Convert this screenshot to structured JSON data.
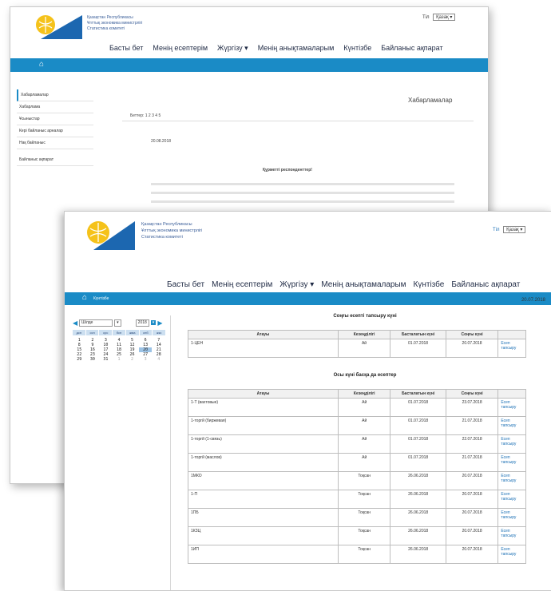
{
  "back_window": {
    "org_lines": [
      "Қазақстан Республикасы",
      "Ұлттық экономика министрлігі",
      "Статистика комитеті"
    ],
    "lang_label": "Тіл",
    "lang_value": "Қазақ",
    "nav": [
      "Басты бет",
      "Менің есептерім",
      "Жүргізу",
      "Менің анықтамаларым",
      "Күнтізбе",
      "Байланыс ақпарат"
    ],
    "sidebar": [
      "Хабарламалар",
      "Хабарлама",
      "Ұсыныстар",
      "Кері байланыс арналар",
      "Нақ байланыс",
      "Байланыс ақпарат"
    ],
    "page_title": "Хабарламалар",
    "pager": "Беттер: 1 2 3 4 5",
    "date": "20.08.2018",
    "heading": "Құрметті респонденттер!"
  },
  "front_window": {
    "org_lines": [
      "Қазақстан Республикасы",
      "Ұлттық экономика министрлігі",
      "Статистика комитеті"
    ],
    "lang_label": "Тіл",
    "lang_value": "Қазақ",
    "nav": [
      "Басты бет",
      "Менің есептерім",
      "Жүргізу",
      "Менің анықтамаларым",
      "Күнтізбе",
      "Байланыс ақпарат"
    ],
    "crumb": "Күнтізбе",
    "calendar": {
      "month": "Шілде",
      "year": "2018",
      "weekdays": [
        "дсн",
        "ссн",
        "срс",
        "бсн",
        "жма",
        "снб",
        "жкс"
      ],
      "days": [
        "1",
        "2",
        "3",
        "4",
        "5",
        "6",
        "7",
        "8",
        "9",
        "10",
        "11",
        "12",
        "13",
        "14",
        "15",
        "16",
        "17",
        "18",
        "19",
        "20",
        "21",
        "22",
        "23",
        "24",
        "25",
        "26",
        "27",
        "28",
        "29",
        "30",
        "31",
        "1",
        "2",
        "3",
        "4"
      ],
      "selected_day": "20"
    },
    "date": "20.07.2018",
    "table1": {
      "caption": "Соңғы есепті тапсыру күні",
      "headers": [
        "Атауы",
        "Кезеңділігі",
        "Басталатын күні",
        "Соңғы күні",
        ""
      ],
      "rows": [
        {
          "name": "1-ЦЕН",
          "period": "Ай",
          "start": "01.07.2018",
          "end": "20.07.2018",
          "link": "Есеп тапсыру"
        }
      ]
    },
    "table2": {
      "caption": "Осы күні басқа да есептер",
      "headers": [
        "Атауы",
        "Кезеңділігі",
        "Басталатын күні",
        "Соңғы күні",
        ""
      ],
      "rows": [
        {
          "name": "1-Т (вахтовые)",
          "period": "Ай",
          "start": "01.07.2018",
          "end": "23.07.2018",
          "link": "Есеп тапсыру"
        },
        {
          "name": "1-торгй (биржевая)",
          "period": "Ай",
          "start": "01.07.2018",
          "end": "21.07.2018",
          "link": "Есеп тапсыру"
        },
        {
          "name": "1-торгй (1-связь)",
          "period": "Ай",
          "start": "01.07.2018",
          "end": "22.07.2018",
          "link": "Есеп тапсыру"
        },
        {
          "name": "1-торгй (маслов)",
          "period": "Ай",
          "start": "01.07.2018",
          "end": "21.07.2018",
          "link": "Есеп тапсыру"
        },
        {
          "name": "1МКО",
          "period": "Тоқсан",
          "start": "26.06.2018",
          "end": "20.07.2018",
          "link": "Есеп тапсыру"
        },
        {
          "name": "1-П",
          "period": "Тоқсан",
          "start": "26.06.2018",
          "end": "20.07.2018",
          "link": "Есеп тапсыру"
        },
        {
          "name": "1ПБ",
          "period": "Тоқсан",
          "start": "26.06.2018",
          "end": "20.07.2018",
          "link": "Есеп тапсыру"
        },
        {
          "name": "1КЗЦ",
          "period": "Тоқсан",
          "start": "26.06.2018",
          "end": "20.07.2018",
          "link": "Есеп тапсыру"
        },
        {
          "name": "1ИП",
          "period": "Тоқсан",
          "start": "26.06.2018",
          "end": "20.07.2018",
          "link": "Есеп тапсыру"
        }
      ]
    }
  },
  "colors": {
    "accent": "#1a8bc6",
    "logo_yellow": "#f5c21a",
    "logo_blue": "#1c67b0"
  }
}
